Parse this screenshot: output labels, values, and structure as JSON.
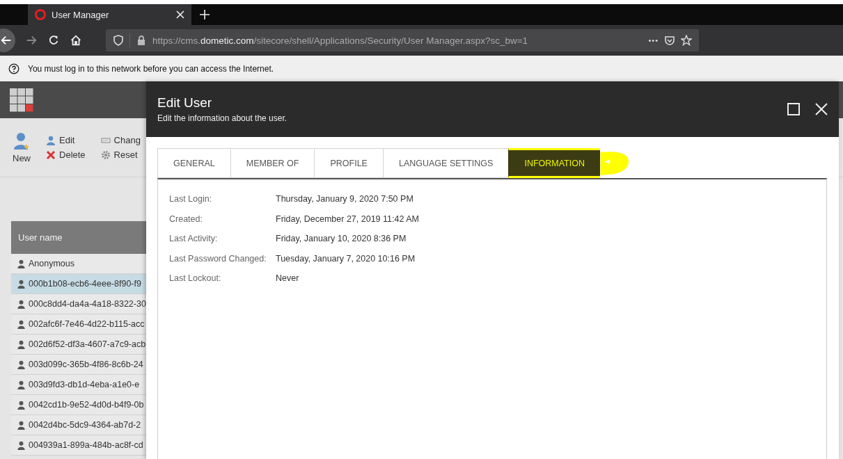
{
  "browser": {
    "tab_title": "User Manager",
    "url_host_prefix": "https://cms.",
    "url_host": "dometic.com",
    "url_path": "/sitecore/shell/Applications/Security/User Manager.aspx?sc_bw=1",
    "more": "•••"
  },
  "infobar": {
    "message": "You must log in to this network before you can access the Internet."
  },
  "toolbar": {
    "new": "New",
    "edit": "Edit",
    "delete": "Delete",
    "change": "Chang",
    "reset": "Reset"
  },
  "users": {
    "column": "User name",
    "rows": [
      {
        "name": "Anonymous",
        "selected": false
      },
      {
        "name": "000b1b08-ecb6-4eee-8f90-f9",
        "selected": true
      },
      {
        "name": "000c8dd4-da4a-4a18-8322-30",
        "selected": false
      },
      {
        "name": "002afc6f-7e46-4d22-b115-acc",
        "selected": false
      },
      {
        "name": "002d6f52-df3a-4607-a7c9-acb",
        "selected": false
      },
      {
        "name": "003d099c-365b-4f86-8c6b-24",
        "selected": false
      },
      {
        "name": "003d9fd3-db1d-4eba-a1e0-e",
        "selected": false
      },
      {
        "name": "0042cd1b-9e52-4d0d-b4f9-0b",
        "selected": false
      },
      {
        "name": "0042d4bc-5dc9-4364-ab7d-2",
        "selected": false
      },
      {
        "name": "004939a1-899a-484b-ac8f-cd",
        "selected": false
      }
    ]
  },
  "dialog": {
    "title": "Edit User",
    "subtitle": "Edit the information about the user.",
    "tabs": [
      {
        "label": "GENERAL",
        "selected": false
      },
      {
        "label": "MEMBER OF",
        "selected": false
      },
      {
        "label": "PROFILE",
        "selected": false
      },
      {
        "label": "LANGUAGE SETTINGS",
        "selected": false
      },
      {
        "label": "INFORMATION",
        "selected": true
      }
    ],
    "info": [
      {
        "label": "Last Login:",
        "value": "Thursday, January 9, 2020 7:50 PM"
      },
      {
        "label": "Created:",
        "value": "Friday, December 27, 2019 11:42 AM"
      },
      {
        "label": "Last Activity:",
        "value": "Friday, January 10, 2020 8:36 PM"
      },
      {
        "label": "Last Password Changed:",
        "value": "Tuesday, January 7, 2020 10:16 PM"
      },
      {
        "label": "Last Lockout:",
        "value": "Never"
      }
    ]
  }
}
